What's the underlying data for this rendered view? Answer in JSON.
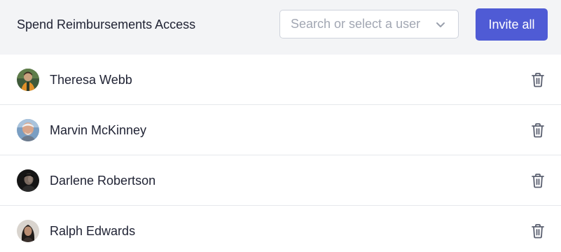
{
  "header": {
    "title": "Spend Reimbursements Access",
    "search_placeholder": "Search or select a user",
    "invite_label": "Invite all"
  },
  "colors": {
    "accent": "#4f5bd5",
    "header_bg": "#f3f4f6",
    "divider": "#e6e8ec"
  },
  "icons": {
    "dropdown": "chevron-down-icon",
    "remove": "trash-icon"
  },
  "users": [
    {
      "name": "Theresa Webb"
    },
    {
      "name": "Marvin McKinney"
    },
    {
      "name": "Darlene Robertson"
    },
    {
      "name": "Ralph Edwards"
    }
  ]
}
